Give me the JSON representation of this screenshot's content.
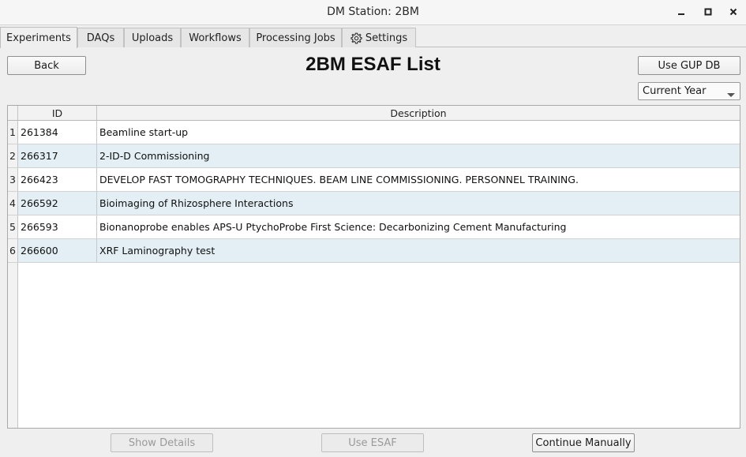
{
  "window": {
    "title": "DM Station: 2BM",
    "controls": [
      "minimize-icon",
      "maximize-icon",
      "close-icon"
    ]
  },
  "tabs": [
    {
      "label": "Experiments",
      "active": true
    },
    {
      "label": "DAQs",
      "active": false
    },
    {
      "label": "Uploads",
      "active": false
    },
    {
      "label": "Workflows",
      "active": false
    },
    {
      "label": "Processing Jobs",
      "active": false
    },
    {
      "label": "Settings",
      "active": false,
      "icon": "gear-icon"
    }
  ],
  "header": {
    "back_label": "Back",
    "title": "2BM ESAF List",
    "gup_label": "Use GUP DB",
    "year_filter": {
      "selected": "Current Year"
    }
  },
  "table": {
    "columns": [
      "ID",
      "Description"
    ],
    "rows": [
      {
        "n": "1",
        "id": "261384",
        "description": "Beamline start-up"
      },
      {
        "n": "2",
        "id": "266317",
        "description": "2-ID-D Commissioning"
      },
      {
        "n": "3",
        "id": "266423",
        "description": "DEVELOP FAST TOMOGRAPHY TECHNIQUES. BEAM LINE COMMISSIONING. PERSONNEL TRAINING."
      },
      {
        "n": "4",
        "id": "266592",
        "description": "Bioimaging of Rhizosphere Interactions"
      },
      {
        "n": "5",
        "id": "266593",
        "description": "Bionanoprobe enables APS-U PtychoProbe First Science: Decarbonizing Cement Manufacturing"
      },
      {
        "n": "6",
        "id": "266600",
        "description": "XRF Laminography test"
      }
    ]
  },
  "footer": {
    "show_details_label": "Show Details",
    "use_esaf_label": "Use ESAF",
    "continue_label": "Continue Manually"
  },
  "colors": {
    "row_alt": "#e3eff4",
    "background": "#efefef"
  }
}
